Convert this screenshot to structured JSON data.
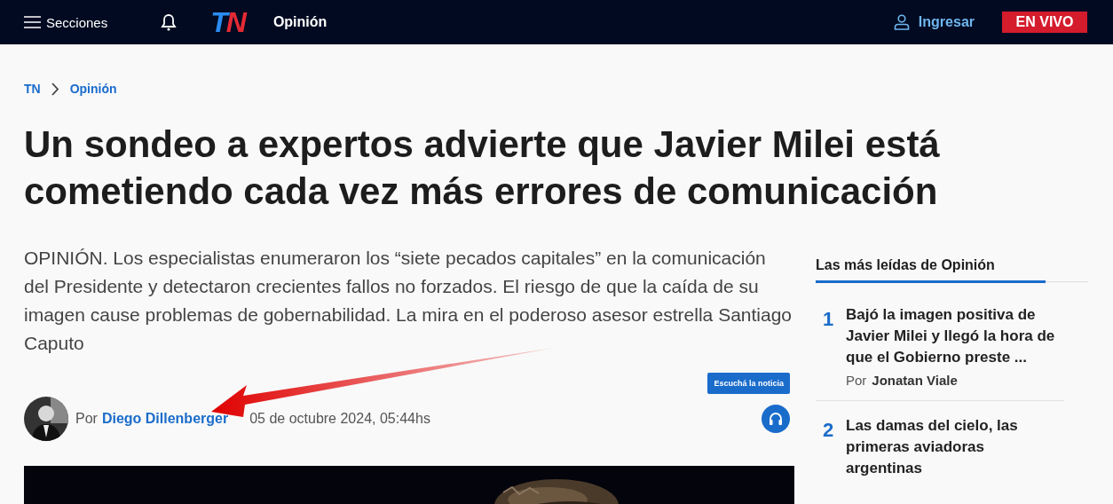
{
  "header": {
    "menu_label": "Secciones",
    "logo": "TN",
    "section": "Opinión",
    "login": "Ingresar",
    "live": "EN VIVO"
  },
  "breadcrumb": [
    "TN",
    "Opinión"
  ],
  "article": {
    "title": "Un sondeo a expertos advierte que Javier Milei está cometiendo cada vez más errores de comunicación",
    "summary": "OPINIÓN. Los especialistas enumeraron los “siete pecados capitales” en la comunicación del Presidente y detectaron crecientes fallos no forzados. El riesgo de que la caída de su imagen cause problemas de gobernabilidad. La mira en el poderoso asesor estrella Santiago Caputo",
    "by": "Por",
    "author": "Diego Dillenberger",
    "date": "05 de octubre 2024, 05:44hs",
    "listen_tooltip": "Escuchá la noticia"
  },
  "sidebar": {
    "heading": "Las más leídas de Opinión",
    "items": [
      {
        "rank": "1",
        "title": "Bajó la imagen positiva de Javier Milei y llegó la hora de que el Gobierno preste ...",
        "by": "Por",
        "author": "Jonatan Viale"
      },
      {
        "rank": "2",
        "title": "Las damas del cielo, las primeras aviadoras argentinas"
      }
    ]
  }
}
